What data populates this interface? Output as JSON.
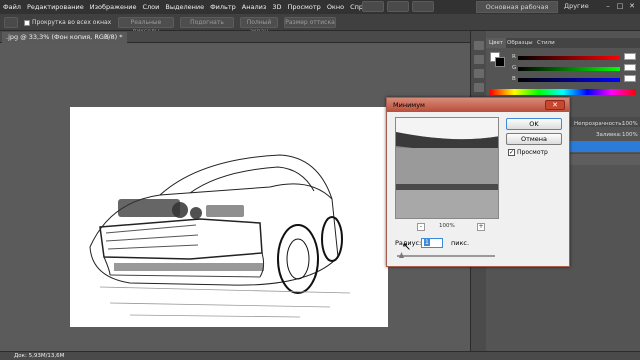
{
  "menu": {
    "items": [
      "Файл",
      "Редактирование",
      "Изображение",
      "Слои",
      "Выделение",
      "Фильтр",
      "Анализ",
      "3D",
      "Просмотр",
      "Окно",
      "Справка"
    ],
    "workspace": "Основная рабочая среда",
    "other": "Другие"
  },
  "options": {
    "scroll_all": "Прокрутка во всех окнах",
    "actual_pixels": "Реальные пикселы",
    "fit_screen": "Подогнать",
    "full_screen": "Полный экран",
    "print_size": "Размер оттиска"
  },
  "document": {
    "tab_title": ".jpg @ 33,3% (Фон копия, RGB/8) *",
    "status": "Док: 5,93M/13,6M"
  },
  "panels": {
    "tabs": [
      "Цвет",
      "Образцы",
      "Стили"
    ],
    "opacity_label": "Непрозрачность:",
    "opacity_value": "100%",
    "fill_label": "Заливка:",
    "fill_value": "100%",
    "channels": [
      "R",
      "G",
      "B"
    ]
  },
  "dialog": {
    "title": "Минимум",
    "ok": "OK",
    "cancel": "Отмена",
    "preview_label": "Просмотр",
    "preview_checked": true,
    "zoom": "100%",
    "zoom_minus": "-",
    "zoom_plus": "+",
    "radius_label": "Радиус:",
    "radius_value": "1",
    "radius_unit": "пикс."
  },
  "colors": {
    "accent": "#3c8ad8",
    "title_bar": "#b94e3c",
    "selection": "#2b7bd8"
  }
}
